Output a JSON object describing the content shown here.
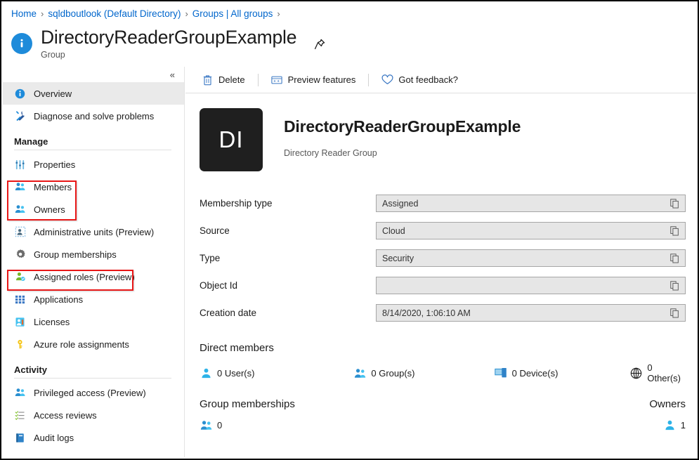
{
  "breadcrumb": {
    "items": [
      {
        "label": "Home"
      },
      {
        "label": "sqldboutlook (Default Directory)"
      },
      {
        "label": "Groups | All groups"
      }
    ],
    "separator": "›"
  },
  "header": {
    "title": "DirectoryReaderGroupExample",
    "subtitle": "Group",
    "info_icon": "info-icon",
    "pin_icon": "pin-icon"
  },
  "sidebar": {
    "collapse_label": "«",
    "items": [
      {
        "label": "Overview",
        "icon": "info-icon",
        "selected": true
      },
      {
        "label": "Diagnose and solve problems",
        "icon": "wrench-icon",
        "selected": false
      }
    ],
    "manage": {
      "section_label": "Manage",
      "items": [
        {
          "label": "Properties",
          "icon": "sliders-icon"
        },
        {
          "label": "Members",
          "icon": "people-icon"
        },
        {
          "label": "Owners",
          "icon": "people-icon"
        },
        {
          "label": "Administrative units (Preview)",
          "icon": "admin-units-icon"
        },
        {
          "label": "Group memberships",
          "icon": "gear-icon"
        },
        {
          "label": "Assigned roles (Preview)",
          "icon": "person-role-icon"
        },
        {
          "label": "Applications",
          "icon": "grid-icon"
        },
        {
          "label": "Licenses",
          "icon": "license-icon"
        },
        {
          "label": "Azure role assignments",
          "icon": "key-icon"
        }
      ]
    },
    "activity": {
      "section_label": "Activity",
      "items": [
        {
          "label": "Privileged access (Preview)",
          "icon": "people-icon"
        },
        {
          "label": "Access reviews",
          "icon": "checklist-icon"
        },
        {
          "label": "Audit logs",
          "icon": "book-icon"
        }
      ]
    }
  },
  "toolbar": {
    "delete_label": "Delete",
    "preview_features_label": "Preview features",
    "feedback_label": "Got feedback?",
    "delete_icon": "trash-icon",
    "preview_icon": "preview-features-icon",
    "feedback_icon": "heart-icon"
  },
  "group": {
    "initials": "DI",
    "name": "DirectoryReaderGroupExample",
    "description": "Directory Reader Group"
  },
  "properties": [
    {
      "label": "Membership type",
      "value": "Assigned",
      "copy_icon": "copy-icon"
    },
    {
      "label": "Source",
      "value": "Cloud",
      "copy_icon": "copy-icon"
    },
    {
      "label": "Type",
      "value": "Security",
      "copy_icon": "copy-icon"
    },
    {
      "label": "Object Id",
      "value": "",
      "copy_icon": "copy-icon"
    },
    {
      "label": "Creation date",
      "value": "8/14/2020, 1:06:10 AM",
      "copy_icon": "copy-icon"
    }
  ],
  "direct_members": {
    "heading": "Direct members",
    "counts": [
      {
        "label": "0 User(s)",
        "icon": "user-icon"
      },
      {
        "label": "0 Group(s)",
        "icon": "group-icon"
      },
      {
        "label": "0 Device(s)",
        "icon": "device-icon"
      },
      {
        "label": "0 Other(s)",
        "icon": "globe-icon"
      }
    ]
  },
  "group_memberships": {
    "heading": "Group memberships",
    "count": "0",
    "icon": "group-icon"
  },
  "owners": {
    "heading": "Owners",
    "count": "1",
    "icon": "user-icon"
  },
  "annotations": {
    "accent_color": "#e81717",
    "boxes": [
      {
        "name": "members-owners-highlight"
      },
      {
        "name": "assigned-roles-highlight"
      }
    ]
  }
}
